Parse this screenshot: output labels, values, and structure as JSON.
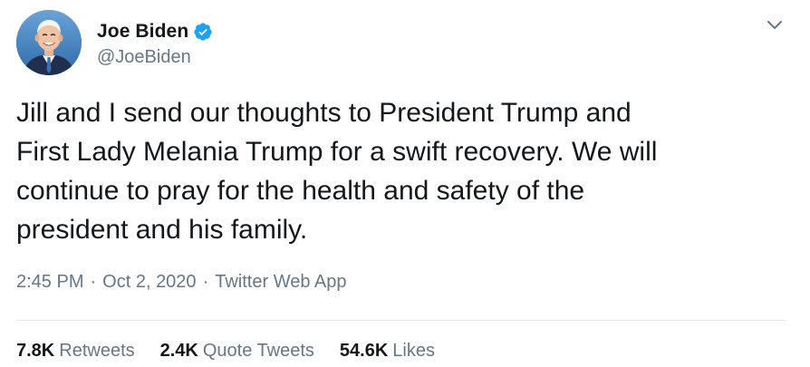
{
  "colors": {
    "text": "#14171a",
    "secondary": "#657786",
    "verified_badge": "#1da1f2",
    "divider": "#e1e8ed"
  },
  "author": {
    "display_name": "Joe Biden",
    "handle": "@JoeBiden",
    "verified_icon": "verified-badge-icon",
    "avatar": "profile-photo"
  },
  "menu": {
    "icon": "chevron-down-icon"
  },
  "tweet": {
    "text": "Jill and I send our thoughts to President Trump and\nFirst Lady Melania Trump for a swift recovery. We will\ncontinue to pray for the health and safety of the\npresident and his family."
  },
  "meta": {
    "time": "2:45 PM",
    "separator": "·",
    "date": "Oct 2, 2020",
    "source": "Twitter Web App"
  },
  "stats": {
    "retweets": {
      "count": "7.8K",
      "label": "Retweets"
    },
    "quote_tweets": {
      "count": "2.4K",
      "label": "Quote Tweets"
    },
    "likes": {
      "count": "54.6K",
      "label": "Likes"
    }
  }
}
